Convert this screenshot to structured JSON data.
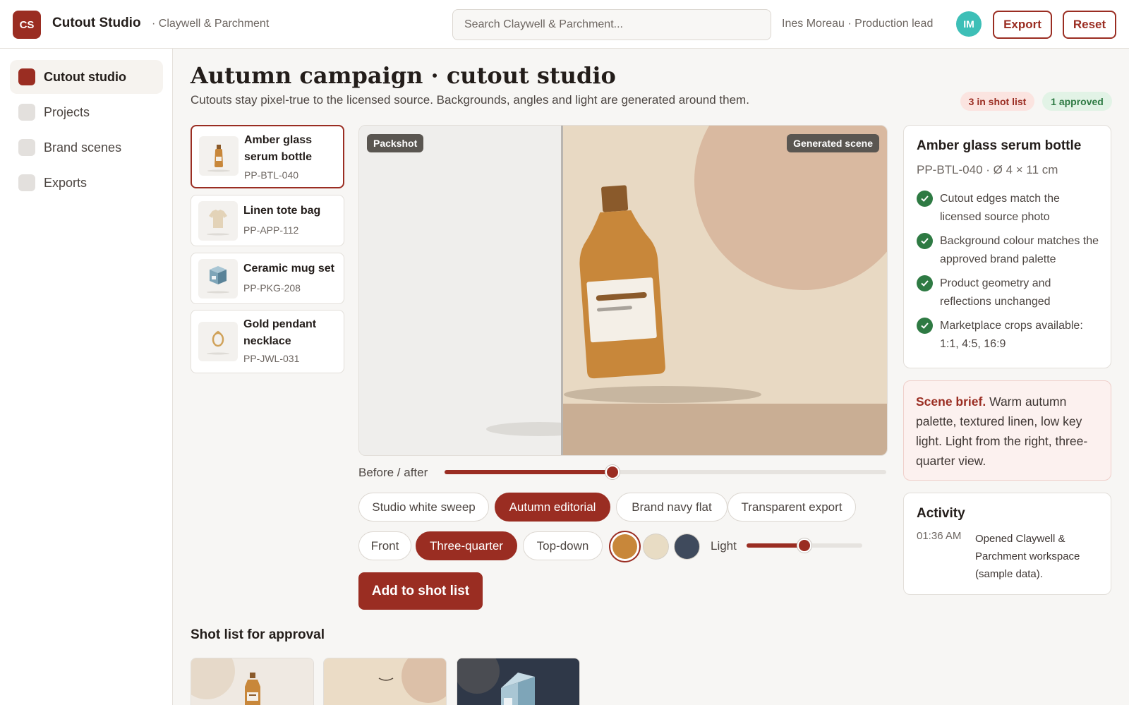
{
  "app": {
    "logo_initials": "CS",
    "title": "Cutout Studio",
    "workspace": "· Claywell & Parchment",
    "search_placeholder": "Search Claywell & Parchment...",
    "user": "Ines Moreau · Production lead",
    "user_initials": "IM",
    "export_label": "Export",
    "reset_label": "Reset"
  },
  "sidebar": {
    "items": [
      {
        "label": "Cutout studio",
        "active": true
      },
      {
        "label": "Projects",
        "active": false
      },
      {
        "label": "Brand scenes",
        "active": false
      },
      {
        "label": "Exports",
        "active": false
      }
    ]
  },
  "page": {
    "title": "Autumn campaign · cutout studio",
    "subtitle": "Cutouts stay pixel-true to the licensed source. Backgrounds, angles and light are generated around them.",
    "badge_shotlist": "3 in shot list",
    "badge_approved": "1 approved"
  },
  "products": [
    {
      "name": "Amber glass serum bottle",
      "sku": "PP-BTL-040",
      "icon": "bottle-icon",
      "selected": true
    },
    {
      "name": "Linen tote bag",
      "sku": "PP-APP-112",
      "icon": "tshirt-icon",
      "selected": false
    },
    {
      "name": "Ceramic mug set",
      "sku": "PP-PKG-208",
      "icon": "box-icon",
      "selected": false
    },
    {
      "name": "Gold pendant necklace",
      "sku": "PP-JWL-031",
      "icon": "pendant-icon",
      "selected": false
    }
  ],
  "canvas": {
    "left_tag": "Packshot",
    "right_tag": "Generated scene",
    "slider_label": "Before / after",
    "slider_value": 0.38
  },
  "scenes": {
    "options": [
      "Studio white sweep",
      "Autumn editorial",
      "Brand navy flat",
      "Transparent export"
    ],
    "selected": "Autumn editorial"
  },
  "angles": {
    "options": [
      "Front",
      "Three-quarter",
      "Top-down"
    ],
    "selected": "Three-quarter"
  },
  "swatches": [
    {
      "color": "#c8873a",
      "selected": true
    },
    {
      "color": "#e8dcc4",
      "selected": false
    },
    {
      "color": "#3f4a5c",
      "selected": false
    }
  ],
  "light": {
    "label": "Light",
    "value": 0.5
  },
  "add_button": "Add to shot list",
  "shotlist": {
    "title": "Shot list for approval"
  },
  "details": {
    "title": "Amber glass serum bottle",
    "meta": "PP-BTL-040 · Ø 4 × 11 cm",
    "checks": [
      "Cutout edges match the licensed source photo",
      "Background colour matches the approved brand palette",
      "Product geometry and reflections unchanged",
      "Marketplace crops available: 1:1, 4:5, 16:9"
    ]
  },
  "brief": {
    "label": "Scene brief.",
    "text": " Warm autumn palette, textured linen, low key light. Light from the right, three-quarter view."
  },
  "activity": {
    "title": "Activity",
    "time": "01:36 AM",
    "text": "Opened Claywell & Parchment workspace (sample data)."
  },
  "colors": {
    "accent": "#9a2d22",
    "success": "#2e7a43",
    "avatar": "#3dbfb7"
  }
}
